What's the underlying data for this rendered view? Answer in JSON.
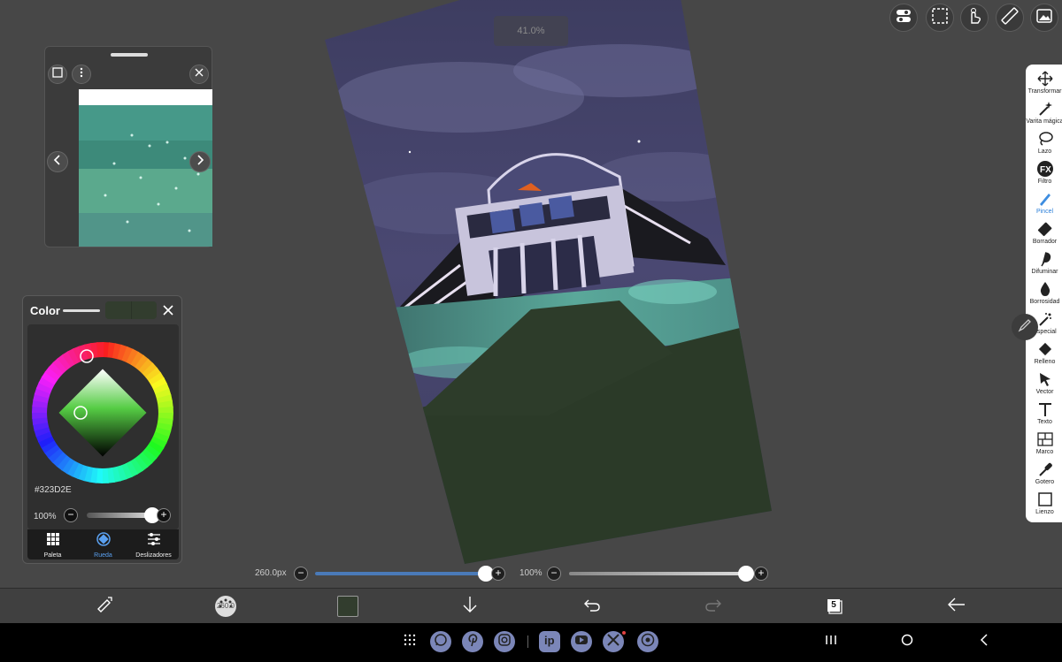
{
  "canvas": {
    "zoom_text": "41.0%"
  },
  "top_tools": [
    {
      "icon": "toggle-settings-icon"
    },
    {
      "icon": "selection-icon"
    },
    {
      "icon": "touch-gesture-icon"
    },
    {
      "icon": "ruler-icon"
    },
    {
      "icon": "image-icon"
    }
  ],
  "toolbar": {
    "tools": [
      {
        "label": "Transformar",
        "icon": "move-icon"
      },
      {
        "label": "Varita mágica",
        "icon": "magic-wand-icon"
      },
      {
        "label": "Lazo",
        "icon": "lasso-icon"
      },
      {
        "label": "Filtro",
        "icon": "fx-icon"
      },
      {
        "label": "Pincel",
        "icon": "brush-icon"
      },
      {
        "label": "Borrador",
        "icon": "eraser-icon"
      },
      {
        "label": "Difuminar",
        "icon": "smudge-icon"
      },
      {
        "label": "Borrosidad",
        "icon": "blur-drop-icon"
      },
      {
        "label": "Especial",
        "icon": "special-icon"
      },
      {
        "label": "Relleno",
        "icon": "fill-icon"
      },
      {
        "label": "Vector",
        "icon": "vector-arrow-icon"
      },
      {
        "label": "Texto",
        "icon": "text-icon"
      },
      {
        "label": "Marco",
        "icon": "frame-icon"
      },
      {
        "label": "Gotero",
        "icon": "eyedropper-icon"
      },
      {
        "label": "Lienzo",
        "icon": "canvas-icon"
      }
    ],
    "active_index": 4
  },
  "color_panel": {
    "title": "Color",
    "hex": "#323D2E",
    "current_color": "#323D2E",
    "opacity_label": "100%",
    "opacity_value": 1.0,
    "tabs": [
      {
        "label": "Paleta",
        "icon": "palette-grid-icon"
      },
      {
        "label": "Rueda",
        "icon": "wheel-icon"
      },
      {
        "label": "Deslizadores",
        "icon": "sliders-icon"
      }
    ],
    "active_tab": 1
  },
  "sliders": {
    "brush_size_label": "260.0px",
    "brush_size_fraction": 0.99,
    "opacity_label": "100%",
    "opacity_fraction": 1.0
  },
  "bottom_bar": {
    "brush_size_badge": "260.0",
    "layer_count": "5"
  },
  "accent_color": "#2b7fd9"
}
